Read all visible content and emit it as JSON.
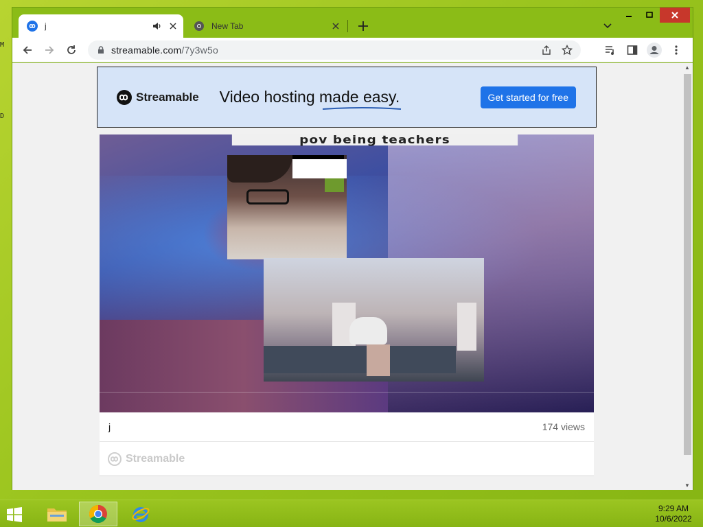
{
  "desktop": {
    "edge_glyph_1": "M",
    "edge_glyph_2": "D"
  },
  "browser": {
    "tabs": [
      {
        "title": "j",
        "active": true
      },
      {
        "title": "New Tab",
        "active": false
      }
    ],
    "url_domain": "streamable.com",
    "url_path": "/7y3w5o"
  },
  "page": {
    "banner": {
      "brand": "Streamable",
      "tagline": "Video hosting made easy.",
      "cta": "Get started for free"
    },
    "video": {
      "caption": "pov being teachers",
      "title": "j",
      "views": "174 views"
    },
    "footer_brand": "Streamable"
  },
  "taskbar": {
    "time": "9:29 AM",
    "date": "10/6/2022"
  },
  "colors": {
    "desktop": "#9ac41e",
    "cta": "#1f73e8",
    "banner_bg": "#d6e4f8",
    "close_button": "#c7372b"
  }
}
